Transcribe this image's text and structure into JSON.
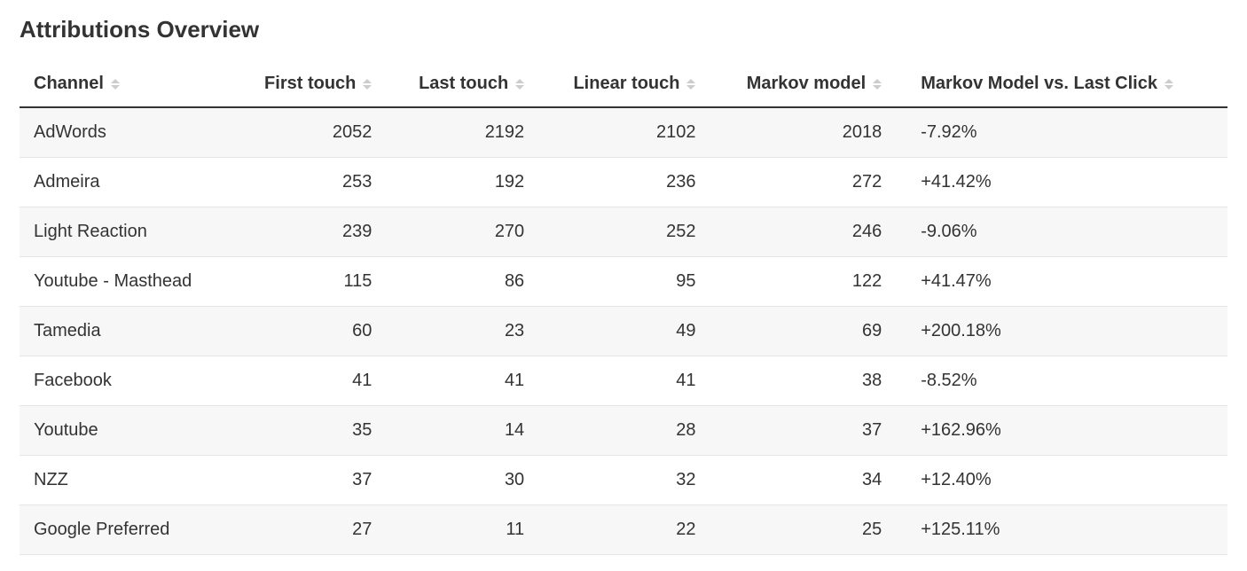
{
  "title": "Attributions Overview",
  "columns": {
    "channel": "Channel",
    "first_touch": "First touch",
    "last_touch": "Last touch",
    "linear_touch": "Linear touch",
    "markov_model": "Markov model",
    "markov_vs_last": "Markov Model vs. Last Click"
  },
  "rows": [
    {
      "channel": "AdWords",
      "first_touch": "2052",
      "last_touch": "2192",
      "linear_touch": "2102",
      "markov_model": "2018",
      "markov_vs_last": "-7.92%"
    },
    {
      "channel": "Admeira",
      "first_touch": "253",
      "last_touch": "192",
      "linear_touch": "236",
      "markov_model": "272",
      "markov_vs_last": "+41.42%"
    },
    {
      "channel": "Light Reaction",
      "first_touch": "239",
      "last_touch": "270",
      "linear_touch": "252",
      "markov_model": "246",
      "markov_vs_last": "-9.06%"
    },
    {
      "channel": "Youtube - Masthead",
      "first_touch": "115",
      "last_touch": "86",
      "linear_touch": "95",
      "markov_model": "122",
      "markov_vs_last": "+41.47%"
    },
    {
      "channel": "Tamedia",
      "first_touch": "60",
      "last_touch": "23",
      "linear_touch": "49",
      "markov_model": "69",
      "markov_vs_last": "+200.18%"
    },
    {
      "channel": "Facebook",
      "first_touch": "41",
      "last_touch": "41",
      "linear_touch": "41",
      "markov_model": "38",
      "markov_vs_last": "-8.52%"
    },
    {
      "channel": "Youtube",
      "first_touch": "35",
      "last_touch": "14",
      "linear_touch": "28",
      "markov_model": "37",
      "markov_vs_last": "+162.96%"
    },
    {
      "channel": "NZZ",
      "first_touch": "37",
      "last_touch": "30",
      "linear_touch": "32",
      "markov_model": "34",
      "markov_vs_last": "+12.40%"
    },
    {
      "channel": "Google Preferred",
      "first_touch": "27",
      "last_touch": "11",
      "linear_touch": "22",
      "markov_model": "25",
      "markov_vs_last": "+125.11%"
    }
  ],
  "chart_data": {
    "type": "table",
    "title": "Attributions Overview",
    "columns": [
      "Channel",
      "First touch",
      "Last touch",
      "Linear touch",
      "Markov model",
      "Markov Model vs. Last Click"
    ],
    "rows": [
      [
        "AdWords",
        2052,
        2192,
        2102,
        2018,
        -7.92
      ],
      [
        "Admeira",
        253,
        192,
        236,
        272,
        41.42
      ],
      [
        "Light Reaction",
        239,
        270,
        252,
        246,
        -9.06
      ],
      [
        "Youtube - Masthead",
        115,
        86,
        95,
        122,
        41.47
      ],
      [
        "Tamedia",
        60,
        23,
        49,
        69,
        200.18
      ],
      [
        "Facebook",
        41,
        41,
        41,
        38,
        -8.52
      ],
      [
        "Youtube",
        35,
        14,
        28,
        37,
        162.96
      ],
      [
        "NZZ",
        37,
        30,
        32,
        34,
        12.4
      ],
      [
        "Google Preferred",
        27,
        11,
        22,
        25,
        125.11
      ]
    ],
    "units": {
      "Markov Model vs. Last Click": "percent"
    }
  }
}
